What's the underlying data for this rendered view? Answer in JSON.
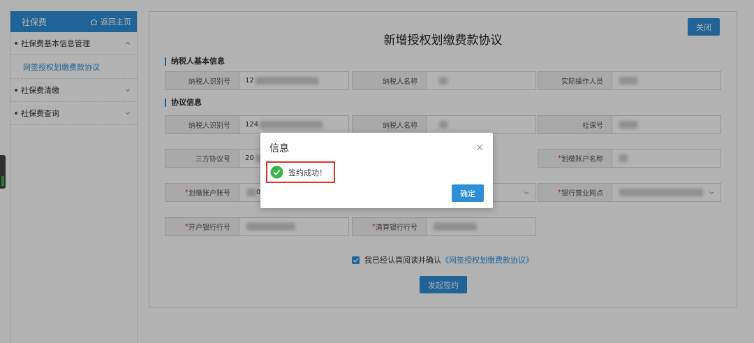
{
  "sidebar": {
    "title": "社保费",
    "home_label": "返回主页",
    "items": [
      {
        "label": "社保费基本信息管理"
      },
      {
        "label": "网签授权划缴费款协议"
      },
      {
        "label": "社保费清缴"
      },
      {
        "label": "社保费查询"
      }
    ]
  },
  "main": {
    "title": "新增授权划缴费款协议",
    "close_label": "关闭",
    "section_basic": "纳税人基本信息",
    "section_protocol": "协议信息",
    "basic_fields": {
      "taxpayer_id_label": "纳税人识别号",
      "taxpayer_id_value": "12",
      "taxpayer_name_label": "纳税人名称",
      "operator_label": "实际操作人员"
    },
    "protocol_fields": {
      "taxpayer_id_label": "纳税人识别号",
      "taxpayer_id_value": "124",
      "taxpayer_name_label": "纳税人名称",
      "social_no_label": "社保号",
      "tripartite_label": "三方协议号",
      "tripartite_value": "20",
      "debit_account_name_label": "划缴账户名称",
      "debit_account_no_label": "划缴账户账号",
      "debit_account_no_value": "0",
      "bank_outlet_label": "银行营业网点",
      "open_bank_no_label": "开户银行行号",
      "clearing_bank_no_label": "清算银行行号"
    },
    "agree_text": "我已经认真阅读并确认",
    "agree_link": "《网签授权划缴费款协议》",
    "submit_label": "发起签约"
  },
  "dialog": {
    "title": "信息",
    "message": "签约成功！",
    "ok_label": "确定"
  },
  "colors": {
    "accent": "#2f8ed8",
    "required": "#e0332b",
    "success": "#3bb54a"
  }
}
